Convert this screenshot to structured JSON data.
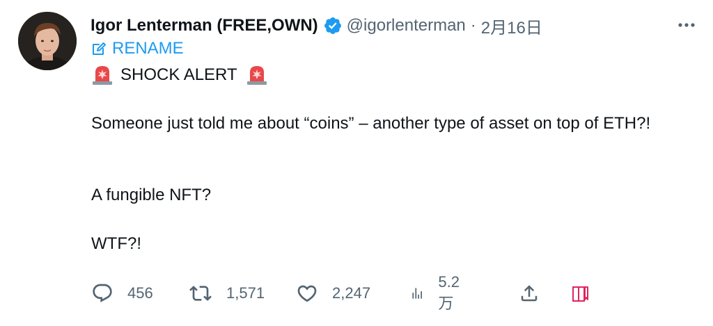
{
  "author": {
    "display_name": "Igor Lenterman (FREE,OWN)",
    "handle": "@igorlenterman",
    "separator": "·",
    "timestamp": "2月16日",
    "verified": true,
    "avatar_icon": "profile-photo"
  },
  "rename": {
    "icon": "edit-icon",
    "label": "RENAME"
  },
  "content": {
    "alert_icon": "police-car-light-emoji",
    "alert_text": "SHOCK ALERT",
    "paragraph_1": "Someone just told me about “coins” – another type of asset on top of ETH?!",
    "paragraph_2": "A fungible NFT?",
    "paragraph_3": "WTF?!"
  },
  "actions": {
    "reply_count": "456",
    "retweet_count": "1,571",
    "like_count": "2,247",
    "views_count": "5.2万"
  },
  "colors": {
    "accent": "#1d9bf0",
    "text": "#0f1419",
    "muted": "#536471",
    "bookmark_pink": "#e0245e"
  }
}
